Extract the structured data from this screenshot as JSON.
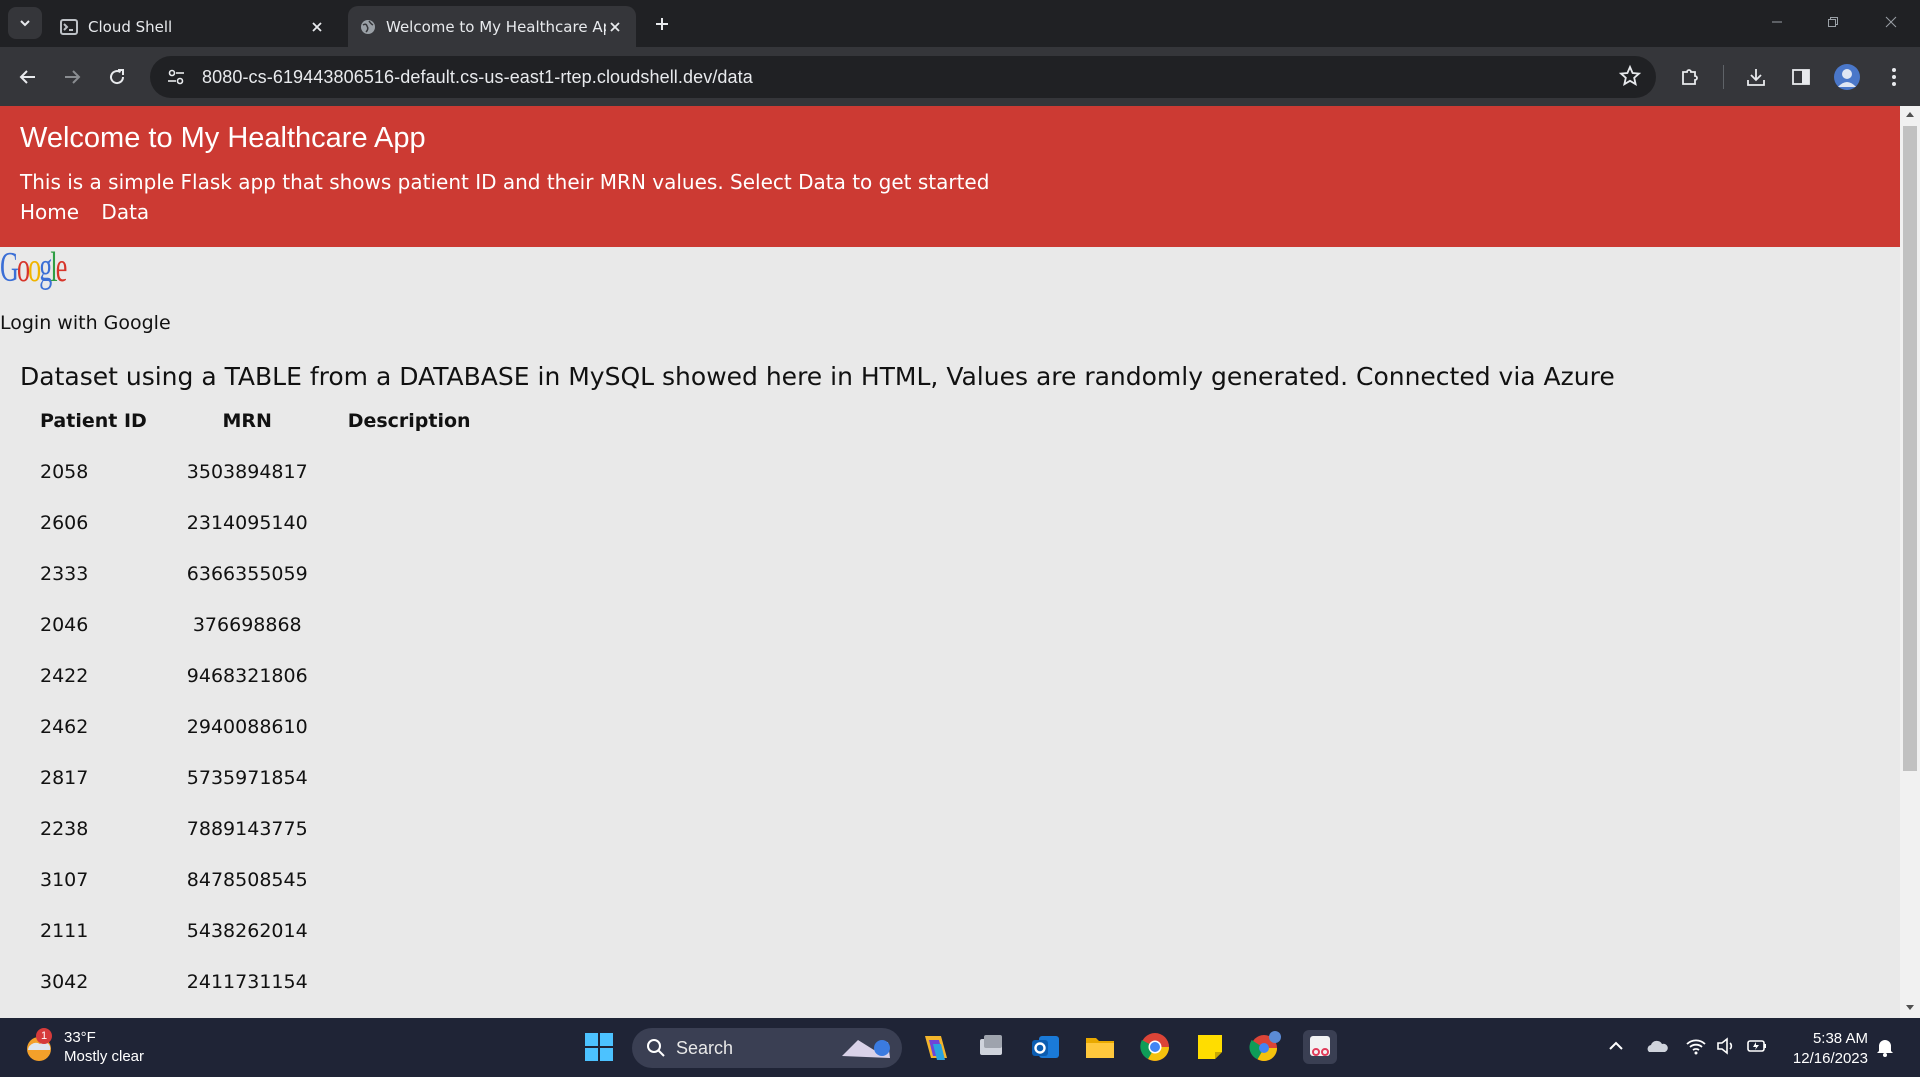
{
  "browser": {
    "tabs": [
      {
        "title": "Cloud Shell",
        "active": false
      },
      {
        "title": "Welcome to My Healthcare App",
        "active": true
      }
    ],
    "url": "8080-cs-619443806516-default.cs-us-east1-rtep.cloudshell.dev/data"
  },
  "header": {
    "title": "Welcome to My Healthcare App",
    "subtitle": "This is a simple Flask app that shows patient ID and their MRN values. Select Data to get started",
    "nav": [
      "Home",
      "Data"
    ],
    "background": "#cc3a33"
  },
  "login": {
    "logo_text": "Google",
    "label": "Login with Google"
  },
  "dataset": {
    "heading": "Dataset using a TABLE from a DATABASE in MySQL showed here in HTML, Values are randomly generated. Connected via Azure",
    "columns": [
      "Patient ID",
      "MRN",
      "Description"
    ],
    "rows": [
      {
        "patient_id": "2058",
        "mrn": "3503894817",
        "description": ""
      },
      {
        "patient_id": "2606",
        "mrn": "2314095140",
        "description": ""
      },
      {
        "patient_id": "2333",
        "mrn": "6366355059",
        "description": ""
      },
      {
        "patient_id": "2046",
        "mrn": "376698868",
        "description": ""
      },
      {
        "patient_id": "2422",
        "mrn": "9468321806",
        "description": ""
      },
      {
        "patient_id": "2462",
        "mrn": "2940088610",
        "description": ""
      },
      {
        "patient_id": "2817",
        "mrn": "5735971854",
        "description": ""
      },
      {
        "patient_id": "2238",
        "mrn": "7889143775",
        "description": ""
      },
      {
        "patient_id": "3107",
        "mrn": "8478508545",
        "description": ""
      },
      {
        "patient_id": "2111",
        "mrn": "5438262014",
        "description": ""
      },
      {
        "patient_id": "3042",
        "mrn": "2411731154",
        "description": ""
      }
    ]
  },
  "taskbar": {
    "weather_temp": "33°F",
    "weather_desc": "Mostly clear",
    "weather_badge": "1",
    "search_label": "Search",
    "time": "5:38 AM",
    "date": "12/16/2023"
  }
}
